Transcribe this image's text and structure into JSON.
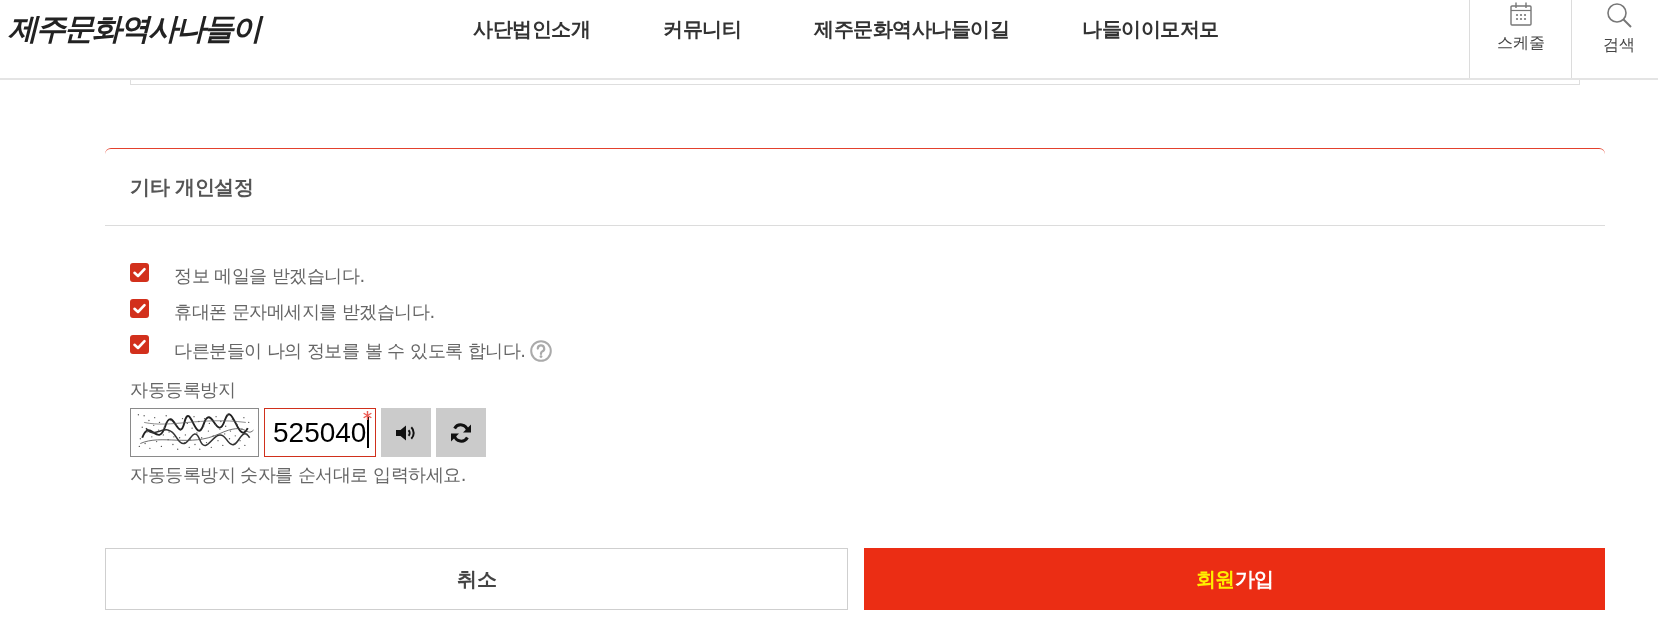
{
  "header": {
    "logo": "제주문화역사나들이",
    "nav": [
      "사단법인소개",
      "커뮤니티",
      "제주문화역사나들이길",
      "나들이이모저모"
    ],
    "utilities": [
      {
        "kind": "calendar",
        "label": "스케줄"
      },
      {
        "kind": "search",
        "label": "검색"
      }
    ]
  },
  "settings": {
    "title": "기타 개인설정",
    "options": [
      {
        "label": "정보 메일을 받겠습니다.",
        "checked": true,
        "help": false
      },
      {
        "label": "휴대폰 문자메세지를 받겠습니다.",
        "checked": true,
        "help": false
      },
      {
        "label": "다른분들이 나의 정보를 볼 수 있도록 합니다.",
        "checked": true,
        "help": true
      }
    ]
  },
  "captcha": {
    "label": "자동등록방지",
    "value": "525040",
    "focused": true,
    "required": true,
    "buttons": [
      {
        "kind": "audio"
      },
      {
        "kind": "refresh"
      }
    ],
    "hint": "자동등록방지 숫자를 순서대로 입력하세요."
  },
  "actions": [
    {
      "kind": "cancel",
      "parts": [
        {
          "text": "취소",
          "highlight": false
        }
      ]
    },
    {
      "kind": "submit",
      "parts": [
        {
          "text": "회원",
          "highlight": true
        },
        {
          "text": "가입",
          "highlight": false
        }
      ]
    }
  ]
}
